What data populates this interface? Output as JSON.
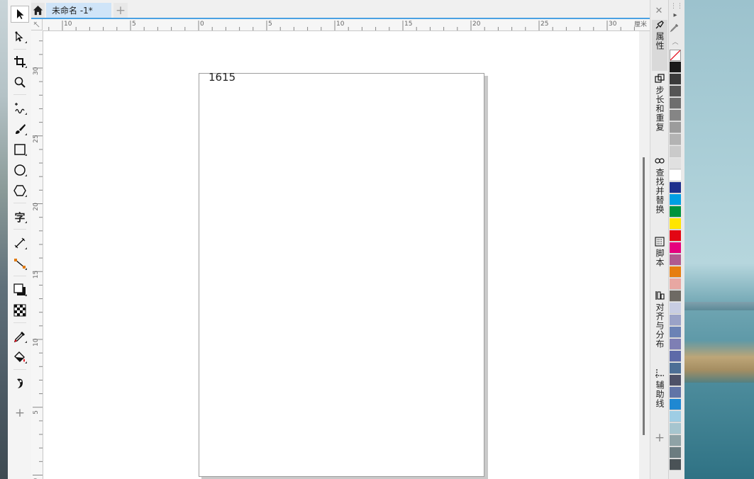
{
  "tabs": {
    "home_label": "",
    "document_label": "未命名 -1*",
    "new_tab_label": "+"
  },
  "ruler": {
    "unit_label": "厘米",
    "top_labels": [
      "10",
      "5",
      "0",
      "5",
      "10",
      "15",
      "20",
      "25",
      "30"
    ],
    "left_labels": [
      "30",
      "25",
      "20",
      "15",
      "10",
      "5",
      "0"
    ]
  },
  "canvas": {
    "page_text": "1615"
  },
  "toolbox": {
    "text_tool_glyph": "字",
    "add_tool_label": "+"
  },
  "dockers": {
    "close_label": "✕",
    "add_label": "+",
    "items": [
      {
        "label": "属性",
        "icon": "properties-icon"
      },
      {
        "label": "步长和重复",
        "icon": "step-repeat-icon"
      },
      {
        "label": "查找并替换",
        "icon": "find-replace-icon"
      },
      {
        "label": "脚本",
        "icon": "script-icon"
      },
      {
        "label": "对齐与分布",
        "icon": "align-distribute-icon"
      },
      {
        "label": "辅助线",
        "icon": "guidelines-icon"
      }
    ]
  },
  "palette": {
    "colors": [
      "#1a1a1a",
      "#3a3a3a",
      "#555555",
      "#6e6e6e",
      "#858585",
      "#9c9c9c",
      "#b3b3b3",
      "#cacaca",
      "#e0e0e0",
      "#ffffff",
      "#1d2f8c",
      "#009fe3",
      "#00933d",
      "#ffe500",
      "#e30613",
      "#e5007e",
      "#b05a8f",
      "#e67e10",
      "#e8a7a2",
      "#6e6a64",
      "#c8cde3",
      "#9aa2c7",
      "#6b82b5",
      "#7e7fb4",
      "#5d6aa8",
      "#4d6f96",
      "#4e5168",
      "#6174a6",
      "#1f88d2",
      "#9ecde4",
      "#a6c5cf",
      "#8fa2a6",
      "#6c7c80",
      "#4a5256"
    ]
  }
}
